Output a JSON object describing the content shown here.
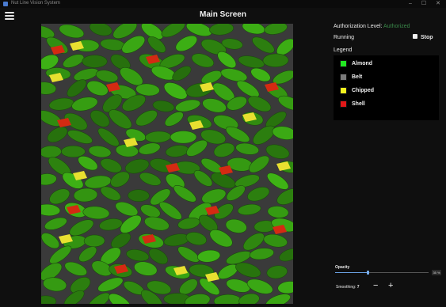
{
  "window": {
    "title": "Nut Line Vision System",
    "minimize": "–",
    "maximize": "☐",
    "close": "✕"
  },
  "header": {
    "title": "Main Screen",
    "menu_icon": "hamburger-icon"
  },
  "status": {
    "authorization_label": "Authorization Level:",
    "authorization_value": "Authorized",
    "authorization_color": "#3a8a4a",
    "running_label": "Running",
    "stop_label": "Stop"
  },
  "legend": {
    "title": "Legend",
    "items": [
      {
        "label": "Almond",
        "color": "#22e622"
      },
      {
        "label": "Belt",
        "color": "#7a7a7a"
      },
      {
        "label": "Chipped",
        "color": "#f2f21e"
      },
      {
        "label": "Shell",
        "color": "#e01818"
      }
    ]
  },
  "opacity": {
    "label": "Opacity",
    "value_text": "35 %",
    "value": 0.35
  },
  "smoothing": {
    "label": "Smoothing:",
    "value": "7",
    "minus": "−",
    "plus": "+"
  }
}
